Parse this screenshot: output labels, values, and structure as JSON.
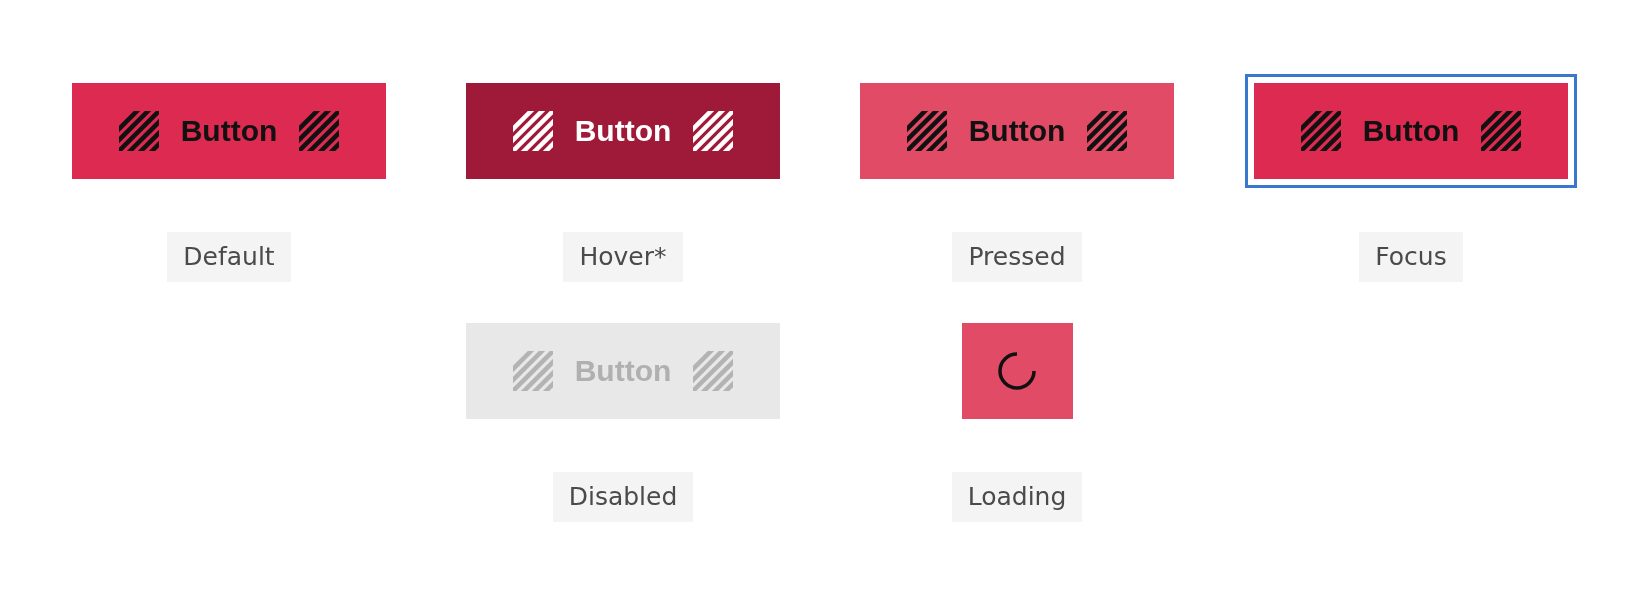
{
  "rows": [
    [
      {
        "kind": "default",
        "text": "Button",
        "label": "Default"
      },
      {
        "kind": "hover",
        "text": "Button",
        "label": "Hover*"
      },
      {
        "kind": "pressed",
        "text": "Button",
        "label": "Pressed"
      },
      {
        "kind": "focus",
        "text": "Button",
        "label": "Focus"
      }
    ],
    [
      {
        "kind": "disabled",
        "text": "Button",
        "label": "Disabled"
      },
      {
        "kind": "loading",
        "label": "Loading"
      }
    ]
  ]
}
